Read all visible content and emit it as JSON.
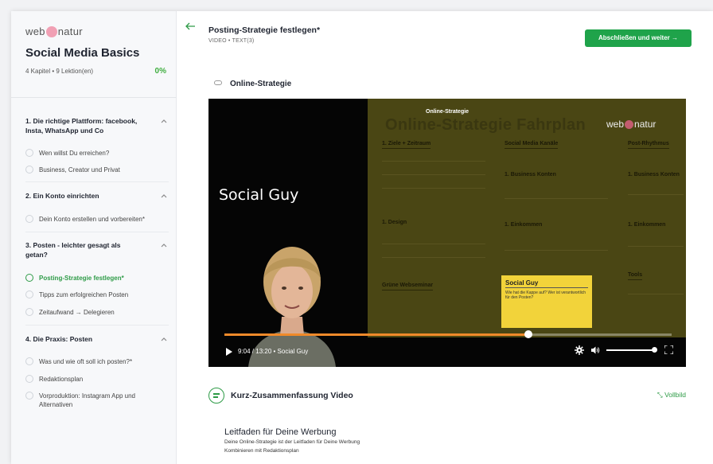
{
  "sidebar": {
    "logo_left": "web",
    "logo_right": "natur",
    "course_title": "Social Media Basics",
    "course_meta": "4 Kapitel  •  9 Lektion(en)",
    "course_progress": "0%",
    "chapters": [
      {
        "title": "1. Die richtige Plattform: facebook, Insta, WhatsApp und Co",
        "lessons": [
          "Wen willst Du erreichen?",
          "Business, Creator und Privat"
        ]
      },
      {
        "title": "2. Ein Konto einrichten",
        "lessons": [
          "Dein Konto erstellen und vorbereiten*"
        ]
      },
      {
        "title": "3. Posten - leichter gesagt als getan?",
        "lessons": [
          "Posting-Strategie festlegen*",
          "Tipps zum erfolgreichen Posten",
          "Zeitaufwand → Delegieren"
        ]
      },
      {
        "title": "4. Die Praxis: Posten",
        "lessons": [
          "Was und wie oft soll ich posten?*",
          "Redaktionsplan",
          "Vorproduktion: Instagram App und Alternativen"
        ]
      }
    ],
    "active_lesson": "Posting-Strategie festlegen*"
  },
  "header": {
    "lesson_title": "Posting-Strategie festlegen*",
    "lesson_type": "VIDEO  •  TEXT(3)",
    "complete_button": "Abschließen und weiter →"
  },
  "section": {
    "title": "Online-Strategie"
  },
  "video": {
    "slide_caption": "Online-Strategie",
    "slide_heading": "Online-Strategie Fahrplan",
    "slide_logo_left": "web",
    "slide_logo_right": "natur",
    "slide_columns": [
      "1. Ziele + Zeitraum",
      "Social Media Kanäle",
      "Post-Rhythmus",
      "1. Business Konten",
      "1. Business Konten",
      "1. Design",
      "1. Einkommen",
      "1. Einkommen",
      "Grüne Webseminar",
      "Tools"
    ],
    "note_title": "Social Guy",
    "note_text": "Wie hat die Kappe auf? Wer ist verantwortlich für den Posten?",
    "speaker_name": "Social Guy",
    "current_time": "9:04",
    "duration": "13:20",
    "chapter_label": "Social Guy",
    "progress": 0.68,
    "volume": 1.0
  },
  "summary": {
    "title": "Kurz-Zusammenfassung Video",
    "fullscreen_label": "Vollbild",
    "doc_title": "Leitfaden für Deine Werbung",
    "doc_lines": [
      "Deine Online-Strategie ist der Leitfaden für Deine Werbung",
      "Kombinieren mit Redaktionsplan"
    ]
  },
  "colors": {
    "accent_green": "#1fa34a",
    "progress_orange": "#f08a2a",
    "note_yellow": "#f2d33a"
  }
}
